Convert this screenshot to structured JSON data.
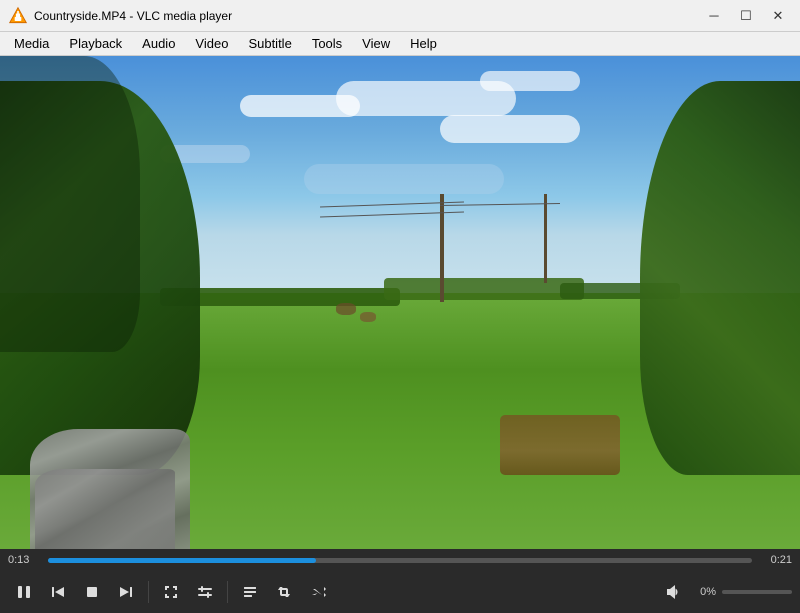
{
  "window": {
    "title": "Countryside.MP4 - VLC media player",
    "icon": "vlc-icon"
  },
  "window_controls": {
    "minimize": "─",
    "maximize": "☐",
    "close": "✕"
  },
  "menu": {
    "items": [
      "Media",
      "Playback",
      "Audio",
      "Video",
      "Subtitle",
      "Tools",
      "View",
      "Help"
    ]
  },
  "player": {
    "current_time": "0:13",
    "total_time": "0:21",
    "progress_percent": 38,
    "volume_percent": 0,
    "volume_label": "0%"
  },
  "controls": {
    "play_pause": "pause",
    "buttons": [
      {
        "id": "skip-back",
        "label": "⏮",
        "title": "Previous"
      },
      {
        "id": "stop",
        "label": "■",
        "title": "Stop"
      },
      {
        "id": "skip-forward",
        "label": "⏭",
        "title": "Next"
      },
      {
        "id": "fullscreen",
        "label": "⛶",
        "title": "Fullscreen"
      },
      {
        "id": "extended",
        "label": "⧉",
        "title": "Extended Settings"
      },
      {
        "id": "playlist",
        "label": "☰",
        "title": "Show Playlist"
      },
      {
        "id": "loop",
        "label": "↺",
        "title": "Loop"
      },
      {
        "id": "random",
        "label": "⤡",
        "title": "Random"
      }
    ]
  }
}
